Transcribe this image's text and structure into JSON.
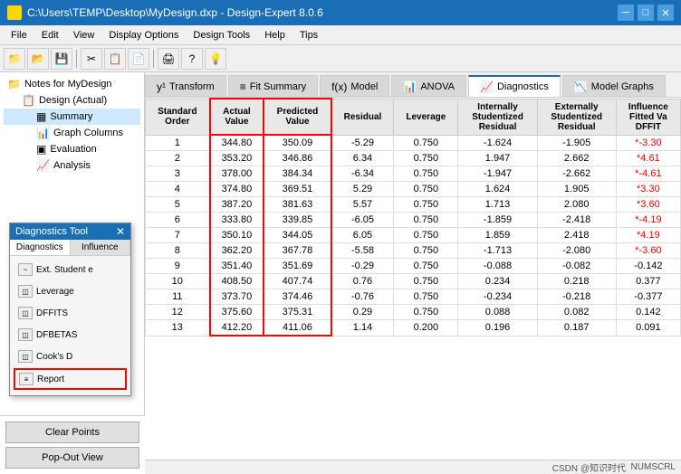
{
  "window": {
    "title": "C:\\Users\\TEMP\\Desktop\\MyDesign.dxp - Design-Expert 8.0.6",
    "icon": "★"
  },
  "menu": {
    "items": [
      "File",
      "Edit",
      "View",
      "Display Options",
      "Design Tools",
      "Help",
      "Tips"
    ]
  },
  "toolbar": {
    "buttons": [
      "📁",
      "📂",
      "💾",
      "✂",
      "📋",
      "📄",
      "🖨",
      "?",
      "💡"
    ]
  },
  "tabs": [
    {
      "label": "Transform",
      "icon": "y¹"
    },
    {
      "label": "Fit Summary",
      "icon": "≡"
    },
    {
      "label": "Model",
      "icon": "f(x)"
    },
    {
      "label": "ANOVA",
      "icon": "📊"
    },
    {
      "label": "Diagnostics",
      "icon": "📈",
      "active": true
    },
    {
      "label": "Model Graphs",
      "icon": "📉"
    }
  ],
  "sidebar": {
    "tree": [
      {
        "label": "Notes for MyDesign",
        "icon": "📁",
        "level": 0
      },
      {
        "label": "Design (Actual)",
        "icon": "📋",
        "level": 1
      },
      {
        "label": "Summary",
        "icon": "▦",
        "level": 2
      },
      {
        "label": "Graph Columns",
        "icon": "📊",
        "level": 2
      },
      {
        "label": "Evaluation",
        "icon": "▣",
        "level": 2
      },
      {
        "label": "Analysis",
        "icon": "📈",
        "level": 2
      }
    ]
  },
  "diagnostics_tool": {
    "title": "Diagnostics Tool",
    "tabs": [
      "Diagnostics",
      "Influence"
    ],
    "items": [
      {
        "label": "Ext. Student e",
        "icon": "~"
      },
      {
        "label": "Leverage",
        "icon": "◫"
      },
      {
        "label": "DFFITS",
        "icon": "◫"
      },
      {
        "label": "DFBETAS",
        "icon": "◫"
      },
      {
        "label": "Cook's D",
        "icon": "◫"
      },
      {
        "label": "Report",
        "icon": "≡",
        "highlighted": true
      }
    ]
  },
  "table": {
    "headers": [
      {
        "label": "Standard\nOrder",
        "key": "order"
      },
      {
        "label": "Actual\nValue",
        "key": "actual",
        "highlight": true
      },
      {
        "label": "Predicted\nValue",
        "key": "predicted",
        "highlight": true
      },
      {
        "label": "Residual",
        "key": "residual"
      },
      {
        "label": "Leverage",
        "key": "leverage"
      },
      {
        "label": "Internally\nStudentized\nResidual",
        "key": "int_stud"
      },
      {
        "label": "Externally\nStudentized\nResidual",
        "key": "ext_stud"
      },
      {
        "label": "Influence\nFitted Va\nDFFIT",
        "key": "dffit"
      }
    ],
    "rows": [
      {
        "order": "1",
        "actual": "344.80",
        "predicted": "350.09",
        "residual": "-5.29",
        "leverage": "0.750",
        "int_stud": "-1.624",
        "ext_stud": "-1.905",
        "dffit": "*-3.30"
      },
      {
        "order": "2",
        "actual": "353.20",
        "predicted": "346.86",
        "residual": "6.34",
        "leverage": "0.750",
        "int_stud": "1.947",
        "ext_stud": "2.662",
        "dffit": "*4.61"
      },
      {
        "order": "3",
        "actual": "378.00",
        "predicted": "384.34",
        "residual": "-6.34",
        "leverage": "0.750",
        "int_stud": "-1.947",
        "ext_stud": "-2.662",
        "dffit": "*-4.61"
      },
      {
        "order": "4",
        "actual": "374.80",
        "predicted": "369.51",
        "residual": "5.29",
        "leverage": "0.750",
        "int_stud": "1.624",
        "ext_stud": "1.905",
        "dffit": "*3.30"
      },
      {
        "order": "5",
        "actual": "387.20",
        "predicted": "381.63",
        "residual": "5.57",
        "leverage": "0.750",
        "int_stud": "1.713",
        "ext_stud": "2.080",
        "dffit": "*3.60"
      },
      {
        "order": "6",
        "actual": "333.80",
        "predicted": "339.85",
        "residual": "-6.05",
        "leverage": "0.750",
        "int_stud": "-1.859",
        "ext_stud": "-2.418",
        "dffit": "*-4.19"
      },
      {
        "order": "7",
        "actual": "350.10",
        "predicted": "344.05",
        "residual": "6.05",
        "leverage": "0.750",
        "int_stud": "1.859",
        "ext_stud": "2.418",
        "dffit": "*4.19"
      },
      {
        "order": "8",
        "actual": "362.20",
        "predicted": "367.78",
        "residual": "-5.58",
        "leverage": "0.750",
        "int_stud": "-1.713",
        "ext_stud": "-2.080",
        "dffit": "*-3.60"
      },
      {
        "order": "9",
        "actual": "351.40",
        "predicted": "351.69",
        "residual": "-0.29",
        "leverage": "0.750",
        "int_stud": "-0.088",
        "ext_stud": "-0.082",
        "dffit": "-0.142"
      },
      {
        "order": "10",
        "actual": "408.50",
        "predicted": "407.74",
        "residual": "0.76",
        "leverage": "0.750",
        "int_stud": "0.234",
        "ext_stud": "0.218",
        "dffit": "0.377"
      },
      {
        "order": "11",
        "actual": "373.70",
        "predicted": "374.46",
        "residual": "-0.76",
        "leverage": "0.750",
        "int_stud": "-0.234",
        "ext_stud": "-0.218",
        "dffit": "-0.377"
      },
      {
        "order": "12",
        "actual": "375.60",
        "predicted": "375.31",
        "residual": "0.29",
        "leverage": "0.750",
        "int_stud": "0.088",
        "ext_stud": "0.082",
        "dffit": "0.142"
      },
      {
        "order": "13",
        "actual": "412.20",
        "predicted": "411.06",
        "residual": "1.14",
        "leverage": "0.200",
        "int_stud": "0.196",
        "ext_stud": "0.187",
        "dffit": "0.091"
      }
    ]
  },
  "bottom_buttons": {
    "clear_points": "Clear Points",
    "pop_out_view": "Pop-Out View"
  },
  "status_bar": {
    "text": "CSDN @知识时代",
    "numscrl": "NUMSCRL"
  }
}
